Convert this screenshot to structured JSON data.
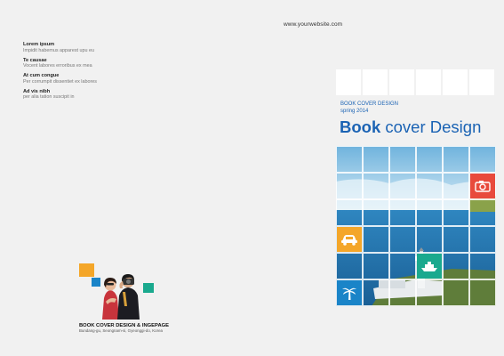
{
  "website": "www.yourwebsite.com",
  "notes": [
    {
      "title": "Lorem ipsum",
      "text": "Impidit habemus apparest upu eu"
    },
    {
      "title": "Te causae",
      "text": "Vocent labores erroribus ex mea"
    },
    {
      "title": "At cum congue",
      "text": "Per corrumpit dissentiet ex labores"
    },
    {
      "title": "Ad vis nibh",
      "text": "per alia tation suscipit in"
    }
  ],
  "back": {
    "title": "BOOK COVER DESIGN & INGEPAGE",
    "address": "Bundang-gu, Seongnam-si, Gyeonggi-do, Korea"
  },
  "cover": {
    "label": "BOOK COVER DESIGN",
    "season": "spring 2014",
    "title_bold": "Book",
    "title_rest": "cover  Design"
  },
  "colors": {
    "brand_blue": "#1b63b4",
    "camera_red": "#e84a3c",
    "car_orange": "#f4a629",
    "ship_green": "#1aa98e",
    "palm_blue": "#1a84c8"
  },
  "icons": [
    "camera-icon",
    "car-icon",
    "ship-icon",
    "palm-tree-icon"
  ]
}
